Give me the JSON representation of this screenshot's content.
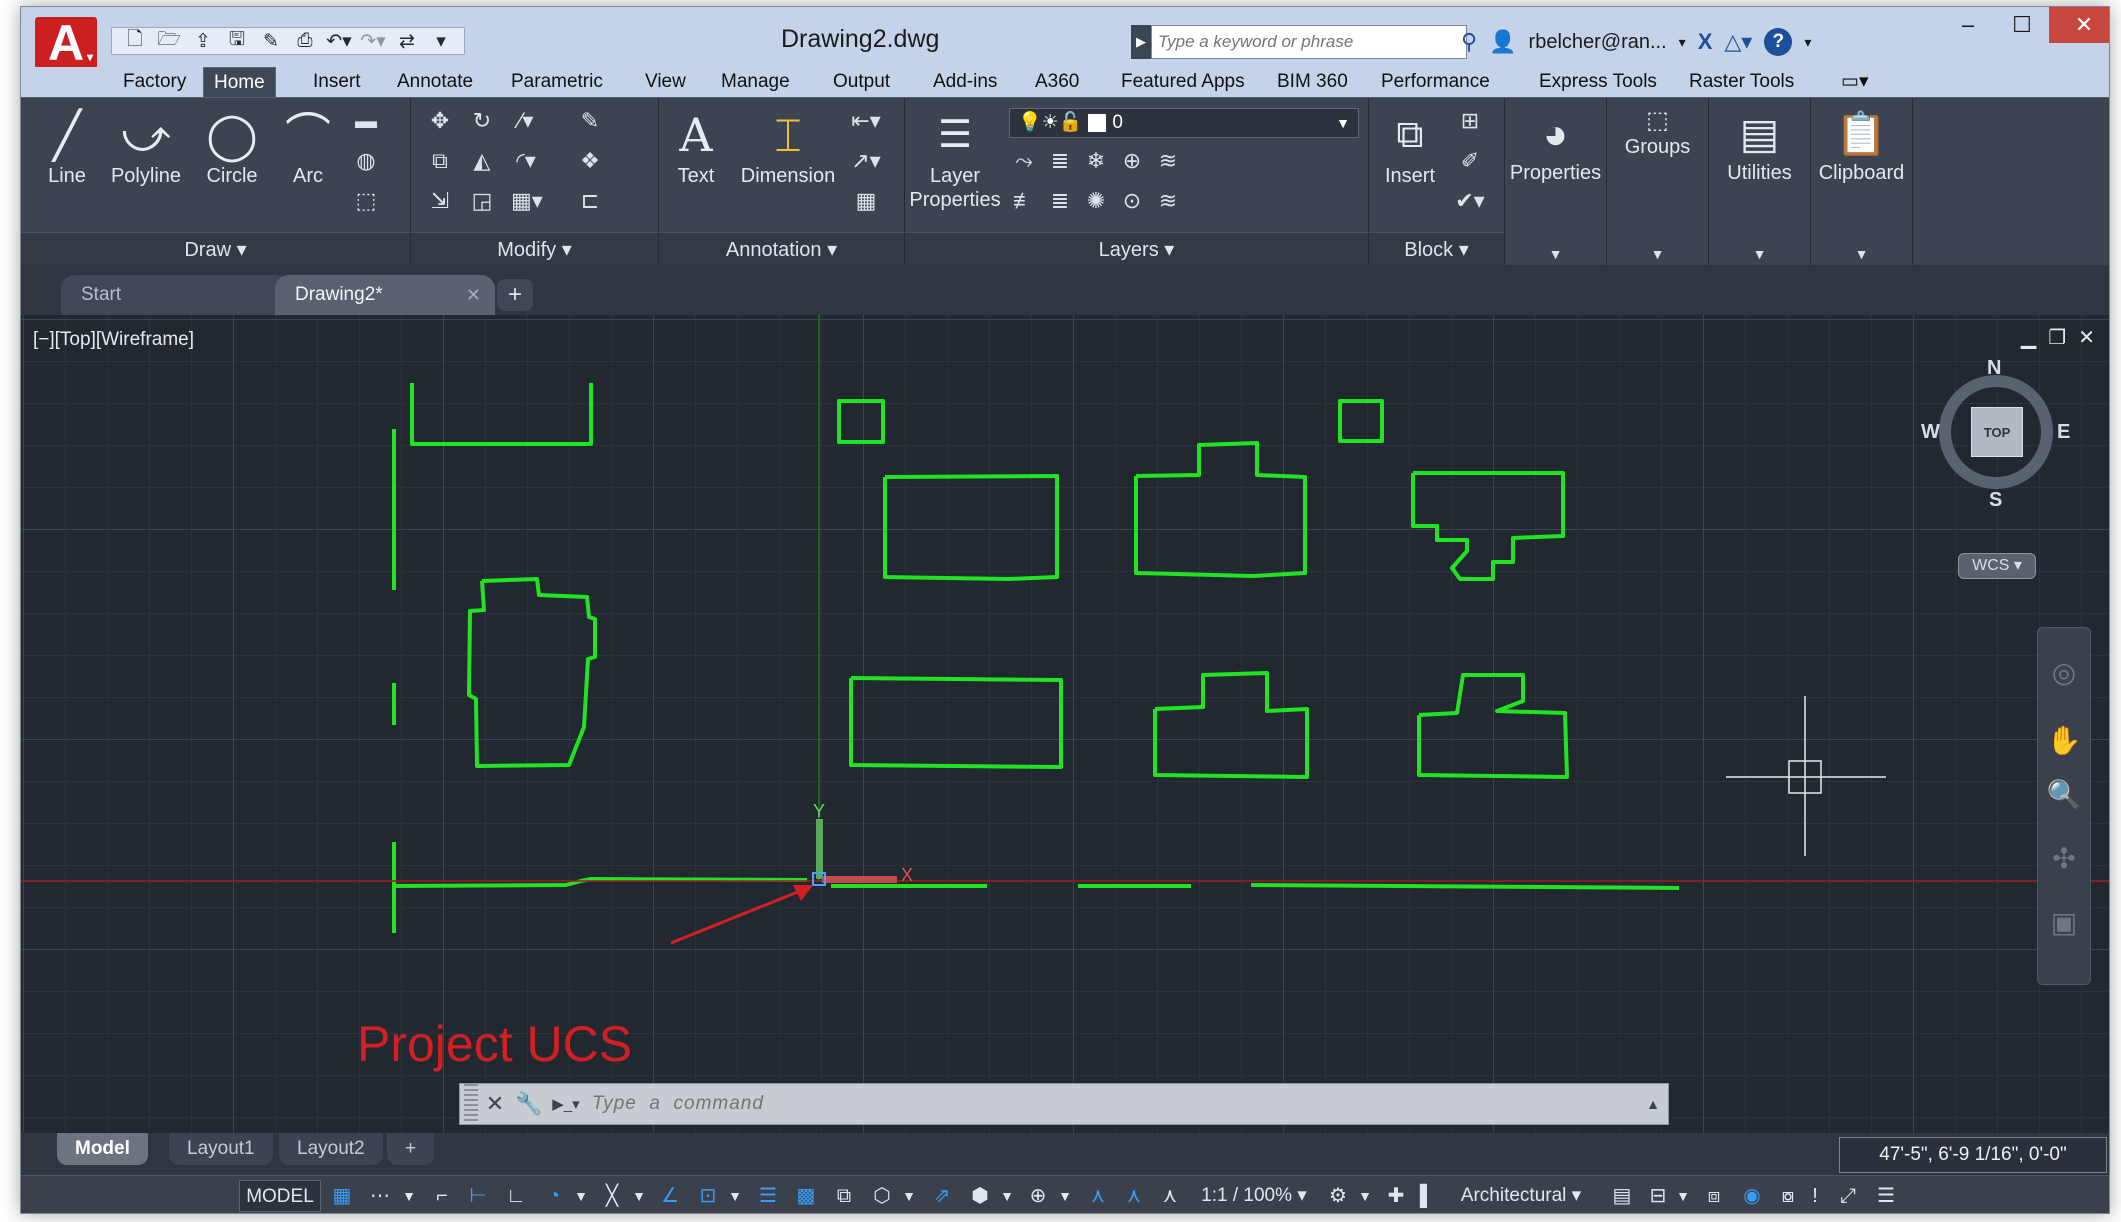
{
  "app": {
    "logo": "A",
    "title": "Drawing2.dwg"
  },
  "quick_access": [
    "new-icon",
    "open-icon",
    "save-cloud-icon",
    "save-icon",
    "save-as-icon",
    "plot-icon",
    "undo-icon",
    "redo-icon",
    "share-icon",
    "customize-icon"
  ],
  "search": {
    "placeholder": "Type a keyword or phrase"
  },
  "user": {
    "name": "rbelcher@ran..."
  },
  "ribbon_tabs": [
    "Factory",
    "Home",
    "Insert",
    "Annotate",
    "Parametric",
    "View",
    "Manage",
    "Output",
    "Add-ins",
    "A360",
    "Featured Apps",
    "BIM 360",
    "Performance",
    "Express Tools",
    "Raster Tools"
  ],
  "active_ribbon_tab": "Home",
  "panels": {
    "draw": {
      "label": "Draw",
      "tools": [
        "Line",
        "Polyline",
        "Circle",
        "Arc"
      ]
    },
    "modify": {
      "label": "Modify"
    },
    "annotation": {
      "label": "Annotation",
      "text": "Text",
      "dimension": "Dimension"
    },
    "layers": {
      "label": "Layers",
      "layer_properties_1": "Layer",
      "layer_properties_2": "Properties",
      "current_layer": "0"
    },
    "block": {
      "label": "Block",
      "insert": "Insert"
    },
    "properties": "Properties",
    "groups": "Groups",
    "utilities": "Utilities",
    "clipboard": "Clipboard"
  },
  "file_tabs": {
    "start": "Start",
    "drawing": "Drawing2*"
  },
  "viewport": {
    "label": "[−][Top][Wireframe]"
  },
  "viewcube": {
    "face": "TOP",
    "north": "N",
    "south": "S",
    "east": "E",
    "west": "W",
    "wcs": "WCS"
  },
  "annotation_text": "Project UCS",
  "command": {
    "placeholder": "Type  a  command"
  },
  "layout_tabs": [
    "Model",
    "Layout1",
    "Layout2"
  ],
  "coordinates": "47'-5\", 6'-9 1/16\", 0'-0\"",
  "status": {
    "model": "MODEL",
    "scale": "1:1 / 100%",
    "units": "Architectural"
  },
  "colors": {
    "geometry": "#22e322",
    "annotation": "#d11f24",
    "background": "#212830",
    "close_button": "#c7463d"
  }
}
